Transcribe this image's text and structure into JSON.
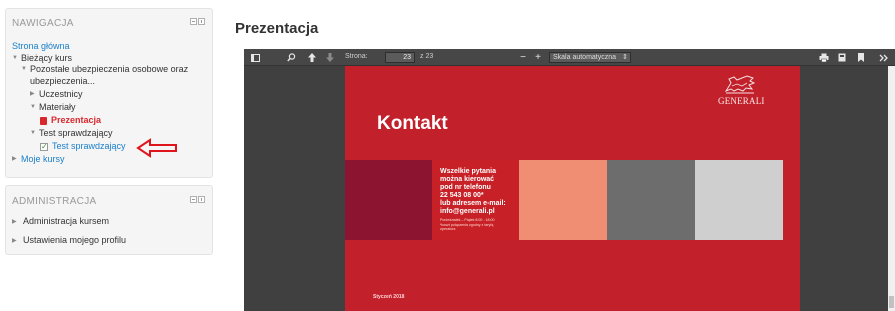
{
  "navigation": {
    "title": "NAWIGACJA",
    "items": [
      {
        "label": "Strona główna"
      },
      {
        "label": "Bieżący kurs"
      },
      {
        "label": "Pozostałe ubezpieczenia osobowe oraz"
      },
      {
        "label": "ubezpieczenia..."
      },
      {
        "label": "Uczestnicy"
      },
      {
        "label": "Materiały"
      },
      {
        "label": "Prezentacja"
      },
      {
        "label": "Test sprawdzający"
      },
      {
        "label": "Test sprawdzający"
      },
      {
        "label": "Moje kursy"
      }
    ]
  },
  "administration": {
    "title": "ADMINISTRACJA",
    "items": [
      {
        "label": "Administracja kursem"
      },
      {
        "label": "Ustawienia mojego profilu"
      }
    ]
  },
  "main": {
    "heading": "Prezentacja"
  },
  "viewer": {
    "page_label": "Strona:",
    "page_value": "23",
    "page_total": "z 23",
    "zoom_out": "−",
    "zoom_in": "+",
    "scale_value": "Skala automatyczna",
    "scale_caret": "⇕"
  },
  "slide": {
    "title": "Kontakt",
    "logo_text": "GENERALI",
    "contact_lines": [
      "Wszelkie pytania",
      "można kierować",
      "pod nr telefonu",
      "22 543 08 00*",
      "lub adresem e-mail:",
      "info@generali.pl"
    ],
    "small_lines": [
      "Poniedziałek – Piątek 8:00 - 18:00",
      "*koszt połączenia zgodny z taryfą",
      "operatora"
    ],
    "date": "Styczeń 2018"
  },
  "colors": {
    "link": "#1a7ec9",
    "current": "#d9272e",
    "slide_red": "#c2202b",
    "arrow_red": "#e0141c",
    "toolbar": "#474747",
    "viewer_bg": "#404040"
  },
  "icons": {
    "block_controls": [
      "minus-icon",
      "dock-icon"
    ],
    "toolbar": [
      "sidebar-toggle-icon",
      "search-icon",
      "previous-page-icon",
      "next-page-icon",
      "print-icon",
      "download-icon",
      "bookmark-icon",
      "tools-icon"
    ]
  }
}
